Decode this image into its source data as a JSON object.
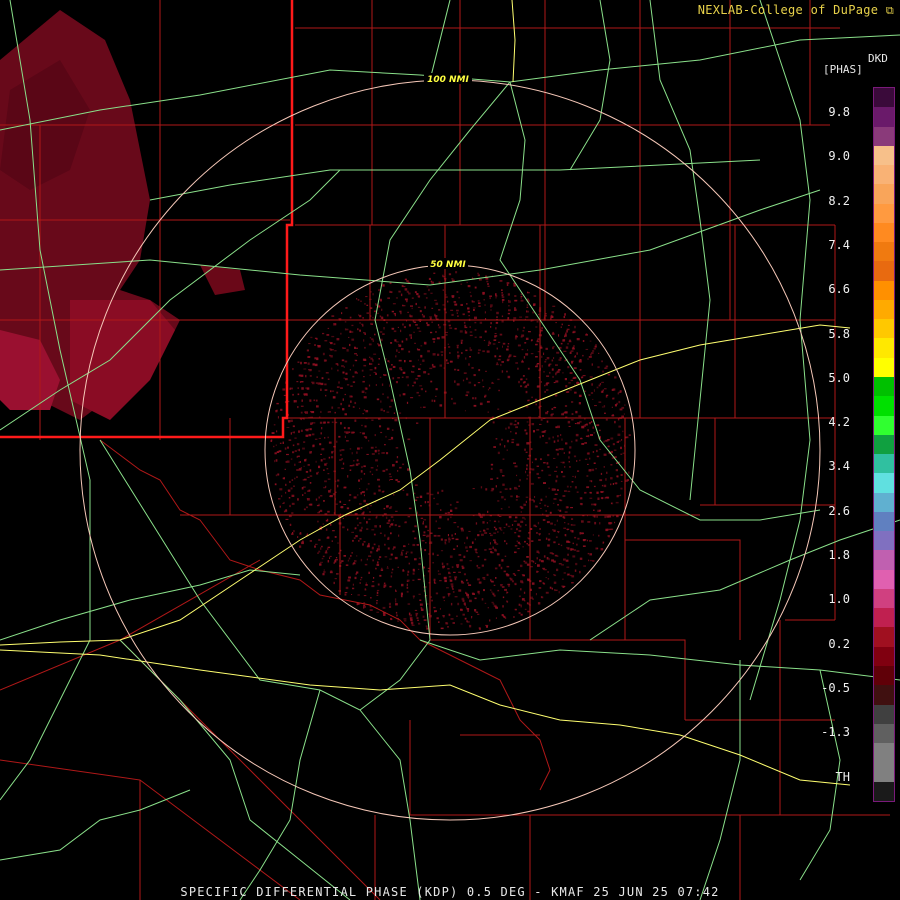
{
  "header": {
    "credit": "NEXLAB-College of DuPage",
    "credit_icon": "external-link-icon"
  },
  "legend": {
    "product_code": "DKD",
    "units": "[PHAS]",
    "ticks": [
      "9.8",
      "9.0",
      "8.2",
      "7.4",
      "6.6",
      "5.8",
      "5.0",
      "4.2",
      "3.4",
      "2.6",
      "1.8",
      "1.0",
      "0.2",
      "-0.5",
      "-1.3",
      "TH"
    ],
    "colors": [
      "#3a0a3a",
      "#6a1a6a",
      "#8a3a7a",
      "#f7c08a",
      "#f9b275",
      "#f9a55a",
      "#ff9a40",
      "#ff8a20",
      "#f07a10",
      "#e86a10",
      "#ff9000",
      "#ffaa00",
      "#ffc800",
      "#ffe800",
      "#ffff00",
      "#00c000",
      "#00e000",
      "#30ff30",
      "#10a040",
      "#30c0a0",
      "#60e0e0",
      "#60b0d0",
      "#6080c0",
      "#8070c0",
      "#c060b0",
      "#e060b0",
      "#d04080",
      "#c02050",
      "#a01020",
      "#800010",
      "#600008",
      "#401010",
      "#404040",
      "#606060",
      "#808080",
      "#808080",
      "#1a1a1a"
    ]
  },
  "rings": [
    {
      "label": "100 NMI"
    },
    {
      "label": "50 NMI"
    }
  ],
  "footer": {
    "caption": "SPECIFIC DIFFERENTIAL PHASE (KDP) 0.5 DEG - KMAF 25 JUN 25 07:42"
  }
}
